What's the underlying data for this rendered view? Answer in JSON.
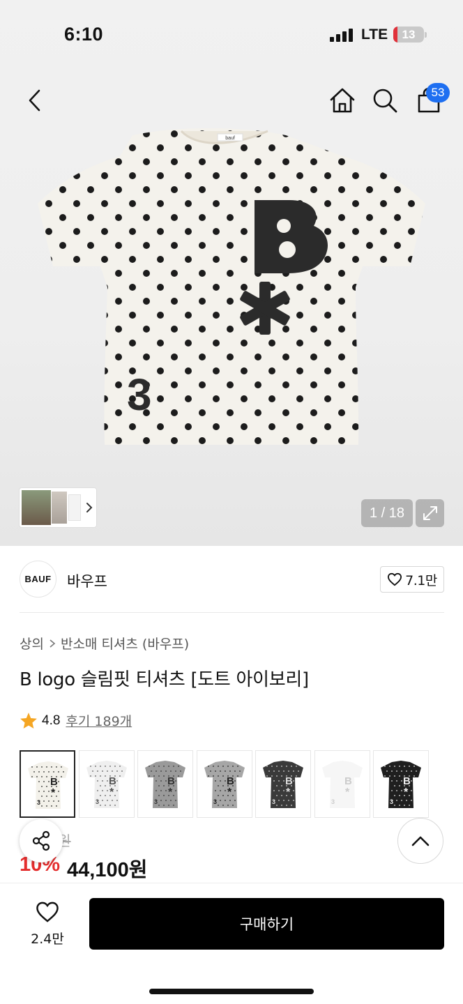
{
  "status_bar": {
    "time": "6:10",
    "network": "LTE",
    "battery": "13",
    "battery_level": 0.13,
    "battery_color": "#e0313a"
  },
  "header": {
    "icons": [
      "back-icon",
      "home-icon",
      "search-icon",
      "bag-icon"
    ],
    "cart_count": "53",
    "badge_color": "#1e6ff1"
  },
  "gallery": {
    "page_counter": "1 / 18",
    "main_image": "polka-dot-tshirt"
  },
  "brand": {
    "logo_text": "BAUF",
    "name": "바우프",
    "like_count": "7.1만"
  },
  "breadcrumb": {
    "category": "상의",
    "subcategory": "반소매 티셔츠 (바우프)"
  },
  "product": {
    "title": "B logo 슬림핏 티셔츠 [도트 아이보리]",
    "rating": "4.8",
    "reviews": "후기 189개",
    "star_color": "#f5a623"
  },
  "color_options": [
    {
      "name": "dot-ivory",
      "body": "#f3f1ea",
      "print": "#222222",
      "dots": true,
      "selected": true
    },
    {
      "name": "dot-light-gray",
      "body": "#efefef",
      "print": "#555555",
      "dots": true,
      "selected": false
    },
    {
      "name": "gray",
      "body": "#9a9a9a",
      "print": "#333333",
      "dots": true,
      "selected": false
    },
    {
      "name": "melange-gray",
      "body": "#a6a6a6",
      "print": "#222222",
      "dots": true,
      "selected": false
    },
    {
      "name": "charcoal",
      "body": "#3a3a3a",
      "print": "#dddddd",
      "dots": true,
      "selected": false
    },
    {
      "name": "white",
      "body": "#f6f6f6",
      "print": "#cccccc",
      "dots": false,
      "selected": false
    },
    {
      "name": "black-dot",
      "body": "#1f1f1f",
      "print": "#eeeeee",
      "dots": true,
      "selected": false
    }
  ],
  "price": {
    "original": "9원",
    "discount": "10%",
    "sale": "44,100원",
    "discount_color": "#e42d2d"
  },
  "bottom_bar": {
    "like_count": "2.4만",
    "buy_label": "구매하기"
  }
}
